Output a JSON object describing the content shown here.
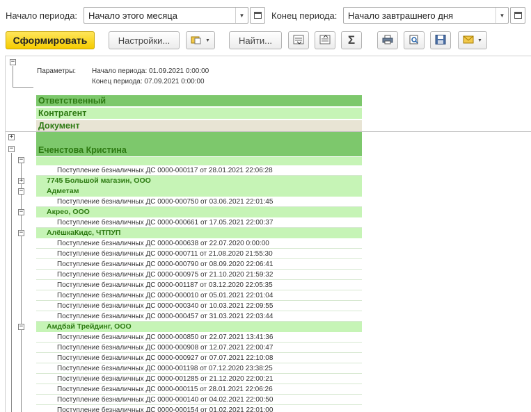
{
  "period": {
    "start_label": "Начало периода:",
    "start_value": "Начало этого месяца",
    "end_label": "Конец периода:",
    "end_value": "Начало завтрашнего дня"
  },
  "toolbar": {
    "generate_label": "Сформировать",
    "settings_label": "Настройки...",
    "find_label": "Найти...",
    "sum_symbol": "Σ"
  },
  "report": {
    "params_label": "Параметры:",
    "params_start": "Начало периода: 01.09.2021 0:00:00",
    "params_end": "Конец периода: 07.09.2021 0:00:00",
    "headers": [
      "Ответственный",
      "Контрагент",
      "Документ"
    ],
    "employee": "Еченстова Кристина",
    "rows": [
      {
        "kind": "doc",
        "text": "Поступление безналичных ДС 0000-000117 от 28.01.2021 22:06:28"
      },
      {
        "kind": "group",
        "text": "7745 Большой магазин, ООО",
        "toggle": "+"
      },
      {
        "kind": "group",
        "text": "Адметам",
        "toggle": "−"
      },
      {
        "kind": "doc",
        "text": "Поступление безналичных ДС 0000-000750 от 03.06.2021 22:01:45"
      },
      {
        "kind": "group",
        "text": "Акрео, ООО",
        "toggle": "−"
      },
      {
        "kind": "doc",
        "text": "Поступление безналичных ДС 0000-000661 от 17.05.2021 22:00:37"
      },
      {
        "kind": "group",
        "text": "АлёшкаКидс, ЧТПУП",
        "toggle": "−"
      },
      {
        "kind": "doc",
        "text": "Поступление безналичных ДС 0000-000638 от 22.07.2020 0:00:00"
      },
      {
        "kind": "doc",
        "text": "Поступление безналичных ДС 0000-000711 от 21.08.2020 21:55:30"
      },
      {
        "kind": "doc",
        "text": "Поступление безналичных ДС 0000-000790 от 08.09.2020 22:06:41"
      },
      {
        "kind": "doc",
        "text": "Поступление безналичных ДС 0000-000975 от 21.10.2020 21:59:32"
      },
      {
        "kind": "doc",
        "text": "Поступление безналичных ДС 0000-001187 от 03.12.2020 22:05:35"
      },
      {
        "kind": "doc",
        "text": "Поступление безналичных ДС 0000-000010 от 05.01.2021 22:01:04"
      },
      {
        "kind": "doc",
        "text": "Поступление безналичных ДС 0000-000340 от 10.03.2021 22:09:55"
      },
      {
        "kind": "doc",
        "text": "Поступление безналичных ДС 0000-000457 от 31.03.2021 22:03:44"
      },
      {
        "kind": "group",
        "text": "Амдбай Трейдинг, ООО",
        "toggle": "−"
      },
      {
        "kind": "doc",
        "text": "Поступление безналичных ДС 0000-000850 от 22.07.2021 13:41:36"
      },
      {
        "kind": "doc",
        "text": "Поступление безналичных ДС 0000-000908 от 12.07.2021 22:00:47"
      },
      {
        "kind": "doc",
        "text": "Поступление безналичных ДС 0000-000927 от 07.07.2021 22:10:08"
      },
      {
        "kind": "doc",
        "text": "Поступление безналичных ДС 0000-001198 от 07.12.2020 23:38:25"
      },
      {
        "kind": "doc",
        "text": "Поступление безналичных ДС 0000-001285 от 21.12.2020 22:00:21"
      },
      {
        "kind": "doc",
        "text": "Поступление безналичных ДС 0000-000115 от 28.01.2021 22:06:26"
      },
      {
        "kind": "doc",
        "text": "Поступление безналичных ДС 0000-000140 от 04.02.2021 22:00:50"
      },
      {
        "kind": "doc",
        "text": "Поступление безналичных ДС 0000-000154 от 01.02.2021 22:01:00"
      }
    ]
  },
  "colors": {
    "primary_button": "#f5cb00",
    "header_dark_green": "#7dc86c",
    "header_light_green": "#c6f4b6",
    "header_beige": "#e8e4d4",
    "group_text": "#2d7a12"
  },
  "icons": [
    "calendar-icon",
    "chevron-down-icon",
    "report-variant-icon",
    "find-next-icon",
    "find-prev-icon",
    "sum-icon",
    "print-icon",
    "preview-icon",
    "save-icon",
    "email-icon"
  ]
}
